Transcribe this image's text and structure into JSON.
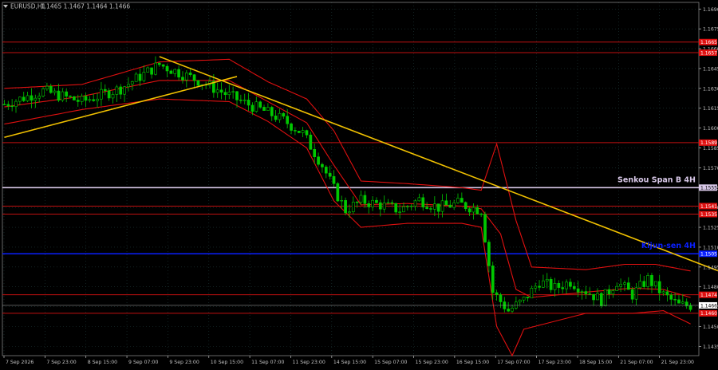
{
  "header": {
    "symbol_label": "EURUSD,H1",
    "ohlc_text": "1.1465 1.1467 1.1464 1.1466"
  },
  "colors": {
    "background": "#000000",
    "grid": "#1f3a3a",
    "axis": "#c0c0c0",
    "candle": "#00c800",
    "envelope": "#e01010",
    "trendline": "#f0c000",
    "senkou": "#d8c8e8",
    "kijun": "#0a20ff",
    "level": "#c01010",
    "price_tag_bg": "#ffffff",
    "level_tag_bg": "#e01010"
  },
  "chart_data": {
    "type": "candlestick",
    "symbol": "EURUSD",
    "timeframe": "H1",
    "ylim": [
      1.1428,
      1.1695
    ],
    "y_ticks": [
      "1.1690",
      "1.1675",
      "1.1660",
      "1.1645",
      "1.1630",
      "1.1615",
      "1.1600",
      "1.1585",
      "1.1570",
      "1.1555",
      "1.1540",
      "1.1525",
      "1.1510",
      "1.1495",
      "1.1480",
      "1.1465",
      "1.1450",
      "1.1435"
    ],
    "x_ticks": [
      "7 Sep 2026",
      "7 Sep 23:00",
      "8 Sep 15:00",
      "9 Sep 07:00",
      "9 Sep 23:00",
      "10 Sep 15:00",
      "11 Sep 07:00",
      "11 Sep 23:00",
      "14 Sep 15:00",
      "15 Sep 07:00",
      "15 Sep 23:00",
      "16 Sep 15:00",
      "17 Sep 07:00",
      "17 Sep 23:00",
      "18 Sep 15:00",
      "21 Sep 07:00",
      "21 Sep 23:00"
    ],
    "current_price": "1.1466",
    "horizontal_levels": [
      {
        "name": "Senkou Span B 4H",
        "value": 1.1555,
        "label": "Senkou Span B 4H",
        "tag": "1.1555",
        "color": "#d8c8e8"
      },
      {
        "name": "Kijun-sen 4H",
        "value": 1.1505,
        "label": "Kijun-sen 4H",
        "tag": "1.1505",
        "color": "#0a20ff"
      },
      {
        "name": "level",
        "value": 1.1665,
        "tag": "1.1665",
        "color": "#c01010"
      },
      {
        "name": "level",
        "value": 1.1657,
        "tag": "1.1657",
        "color": "#c01010"
      },
      {
        "name": "level",
        "value": 1.1589,
        "tag": "1.1589",
        "color": "#c01010"
      },
      {
        "name": "level",
        "value": 1.1541,
        "tag": "1.1541",
        "color": "#c01010"
      },
      {
        "name": "level",
        "value": 1.1535,
        "tag": "1.1535",
        "color": "#c01010"
      },
      {
        "name": "level",
        "value": 1.1474,
        "tag": "1.1474",
        "color": "#c01010"
      },
      {
        "name": "level",
        "value": 1.146,
        "tag": "1.1460",
        "color": "#c01010"
      }
    ],
    "trendlines": [
      {
        "from": [
          0,
          1.1593
        ],
        "to": [
          60,
          1.1639
        ],
        "color": "#f0c000"
      },
      {
        "from": [
          40,
          1.1654
        ],
        "to": [
          186,
          1.149
        ],
        "color": "#f0c000"
      }
    ],
    "candles": {
      "count": 178,
      "path": [
        [
          0,
          1.1618
        ],
        [
          10,
          1.1628
        ],
        [
          20,
          1.162
        ],
        [
          30,
          1.163
        ],
        [
          40,
          1.1648
        ],
        [
          50,
          1.1636
        ],
        [
          57,
          1.1626
        ],
        [
          62,
          1.1619
        ],
        [
          67,
          1.1613
        ],
        [
          72,
          1.1606
        ],
        [
          77,
          1.1596
        ],
        [
          82,
          1.1572
        ],
        [
          85,
          1.1554
        ],
        [
          88,
          1.1538
        ],
        [
          92,
          1.1545
        ],
        [
          97,
          1.1542
        ],
        [
          102,
          1.1538
        ],
        [
          107,
          1.1546
        ],
        [
          112,
          1.154
        ],
        [
          117,
          1.1543
        ],
        [
          123,
          1.1538
        ],
        [
          126,
          1.1476
        ],
        [
          130,
          1.1462
        ],
        [
          134,
          1.147
        ],
        [
          138,
          1.1484
        ],
        [
          142,
          1.1479
        ],
        [
          146,
          1.1484
        ],
        [
          150,
          1.1477
        ],
        [
          154,
          1.147
        ],
        [
          158,
          1.1484
        ],
        [
          162,
          1.1474
        ],
        [
          166,
          1.1486
        ],
        [
          170,
          1.1474
        ],
        [
          174,
          1.1466
        ],
        [
          177,
          1.1466
        ]
      ]
    },
    "envelope": {
      "upper": [
        [
          0,
          1.163
        ],
        [
          20,
          1.1633
        ],
        [
          40,
          1.165
        ],
        [
          58,
          1.1652
        ],
        [
          68,
          1.1635
        ],
        [
          78,
          1.1622
        ],
        [
          85,
          1.1598
        ],
        [
          92,
          1.156
        ],
        [
          104,
          1.1558
        ],
        [
          118,
          1.1555
        ],
        [
          123,
          1.1553
        ],
        [
          127,
          1.1588
        ],
        [
          132,
          1.153
        ],
        [
          136,
          1.1495
        ],
        [
          150,
          1.1493
        ],
        [
          160,
          1.1497
        ],
        [
          168,
          1.1497
        ],
        [
          177,
          1.1492
        ]
      ],
      "lower": [
        [
          0,
          1.1603
        ],
        [
          20,
          1.1614
        ],
        [
          40,
          1.1622
        ],
        [
          58,
          1.162
        ],
        [
          68,
          1.1605
        ],
        [
          78,
          1.1585
        ],
        [
          85,
          1.1545
        ],
        [
          92,
          1.1525
        ],
        [
          104,
          1.1528
        ],
        [
          118,
          1.1528
        ],
        [
          123,
          1.1525
        ],
        [
          127,
          1.145
        ],
        [
          131,
          1.1428
        ],
        [
          134,
          1.1448
        ],
        [
          150,
          1.146
        ],
        [
          162,
          1.146
        ],
        [
          170,
          1.1462
        ],
        [
          177,
          1.1452
        ]
      ],
      "middle": [
        [
          0,
          1.1616
        ],
        [
          20,
          1.1624
        ],
        [
          40,
          1.1636
        ],
        [
          58,
          1.1636
        ],
        [
          68,
          1.162
        ],
        [
          78,
          1.1604
        ],
        [
          85,
          1.1572
        ],
        [
          92,
          1.1542
        ],
        [
          104,
          1.1543
        ],
        [
          118,
          1.1541
        ],
        [
          123,
          1.1539
        ],
        [
          128,
          1.152
        ],
        [
          132,
          1.1478
        ],
        [
          136,
          1.1472
        ],
        [
          150,
          1.1476
        ],
        [
          162,
          1.1479
        ],
        [
          170,
          1.1478
        ],
        [
          177,
          1.1472
        ]
      ]
    }
  }
}
